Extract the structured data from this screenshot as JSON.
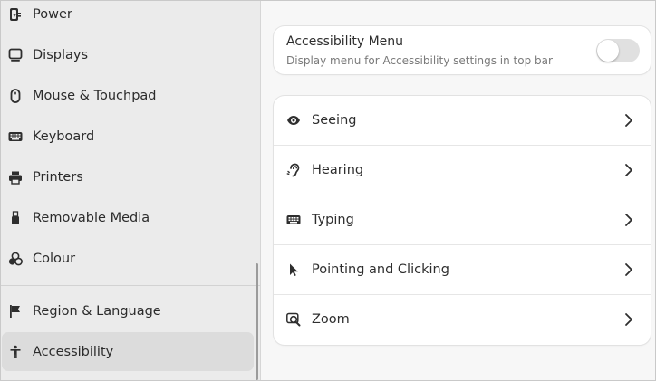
{
  "sidebar": {
    "items": [
      {
        "label": "Power",
        "icon": "power-icon"
      },
      {
        "label": "Displays",
        "icon": "display-icon"
      },
      {
        "label": "Mouse & Touchpad",
        "icon": "mouse-icon"
      },
      {
        "label": "Keyboard",
        "icon": "keyboard-icon"
      },
      {
        "label": "Printers",
        "icon": "printer-icon"
      },
      {
        "label": "Removable Media",
        "icon": "usb-icon"
      },
      {
        "label": "Colour",
        "icon": "colour-icon"
      },
      {
        "label": "Region & Language",
        "icon": "flag-icon"
      },
      {
        "label": "Accessibility",
        "icon": "accessibility-icon",
        "active": true
      }
    ]
  },
  "main": {
    "accessibility_menu": {
      "title": "Accessibility Menu",
      "subtitle": "Display menu for Accessibility settings in top bar",
      "enabled": false
    },
    "rows": [
      {
        "label": "Seeing",
        "icon": "eye-icon"
      },
      {
        "label": "Hearing",
        "icon": "ear-icon"
      },
      {
        "label": "Typing",
        "icon": "keyboard-icon"
      },
      {
        "label": "Pointing and Clicking",
        "icon": "pointer-icon"
      },
      {
        "label": "Zoom",
        "icon": "zoom-icon"
      }
    ]
  },
  "colors": {
    "sidebar_bg": "#ebebeb",
    "sidebar_active": "#dcdcdc",
    "card_bg": "#ffffff",
    "switch_off": "#e0e0e0"
  }
}
